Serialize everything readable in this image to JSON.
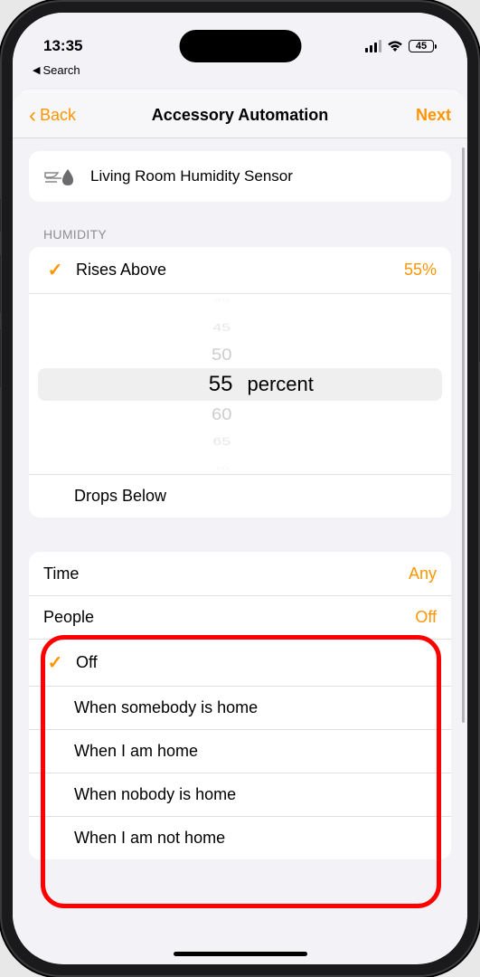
{
  "status": {
    "time": "13:35",
    "battery_level": "45"
  },
  "breadcrumb": {
    "label": "Search"
  },
  "nav": {
    "back": "Back",
    "title": "Accessory Automation",
    "next": "Next"
  },
  "accessory": {
    "name": "Living Room Humidity Sensor"
  },
  "humidity": {
    "section_title": "HUMIDITY",
    "rises_above_label": "Rises Above",
    "rises_above_value": "55%",
    "drops_below_label": "Drops Below",
    "picker_unit": "percent",
    "picker_options": [
      "40",
      "45",
      "50",
      "55",
      "60",
      "65",
      "70"
    ],
    "picker_selected": "55"
  },
  "time_row": {
    "label": "Time",
    "value": "Any"
  },
  "people": {
    "label": "People",
    "value": "Off",
    "options": [
      {
        "label": "Off",
        "selected": true
      },
      {
        "label": "When somebody is home",
        "selected": false
      },
      {
        "label": "When I am home",
        "selected": false
      },
      {
        "label": "When nobody is home",
        "selected": false
      },
      {
        "label": "When I am not home",
        "selected": false
      }
    ]
  }
}
